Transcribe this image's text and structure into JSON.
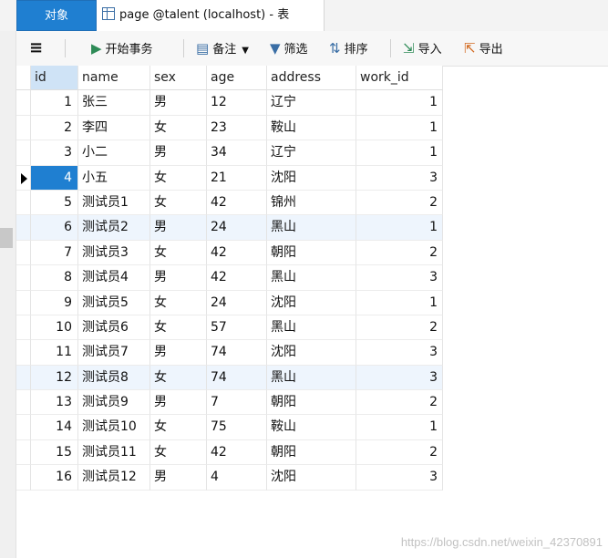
{
  "tabs": {
    "objects_label": "对象",
    "active_label": "page @talent (localhost) - 表"
  },
  "toolbar": {
    "menu_icon": "≡",
    "begin_transaction": "开始事务",
    "note": "备注",
    "filter": "筛选",
    "sort": "排序",
    "import": "导入",
    "export": "导出"
  },
  "table": {
    "columns": [
      "id",
      "name",
      "sex",
      "age",
      "address",
      "work_id"
    ],
    "rows": [
      [
        "1",
        "张三",
        "男",
        "12",
        "辽宁",
        "1"
      ],
      [
        "2",
        "李四",
        "女",
        "23",
        "鞍山",
        "1"
      ],
      [
        "3",
        "小二",
        "男",
        "34",
        "辽宁",
        "1"
      ],
      [
        "4",
        "小五",
        "女",
        "21",
        "沈阳",
        "3"
      ],
      [
        "5",
        "测试员1",
        "女",
        "42",
        "锦州",
        "2"
      ],
      [
        "6",
        "测试员2",
        "男",
        "24",
        "黑山",
        "1"
      ],
      [
        "7",
        "测试员3",
        "女",
        "42",
        "朝阳",
        "2"
      ],
      [
        "8",
        "测试员4",
        "男",
        "42",
        "黑山",
        "3"
      ],
      [
        "9",
        "测试员5",
        "女",
        "24",
        "沈阳",
        "1"
      ],
      [
        "10",
        "测试员6",
        "女",
        "57",
        "黑山",
        "2"
      ],
      [
        "11",
        "测试员7",
        "男",
        "74",
        "沈阳",
        "3"
      ],
      [
        "12",
        "测试员8",
        "女",
        "74",
        "黑山",
        "3"
      ],
      [
        "13",
        "测试员9",
        "男",
        "7",
        "朝阳",
        "2"
      ],
      [
        "14",
        "测试员10",
        "女",
        "75",
        "鞍山",
        "1"
      ],
      [
        "15",
        "测试员11",
        "女",
        "42",
        "朝阳",
        "2"
      ],
      [
        "16",
        "测试员12",
        "男",
        "4",
        "沈阳",
        "3"
      ]
    ],
    "selected_row": 3,
    "highlighted_rows": [
      5,
      11
    ]
  },
  "watermark": "https://blog.csdn.net/weixin_42370891"
}
